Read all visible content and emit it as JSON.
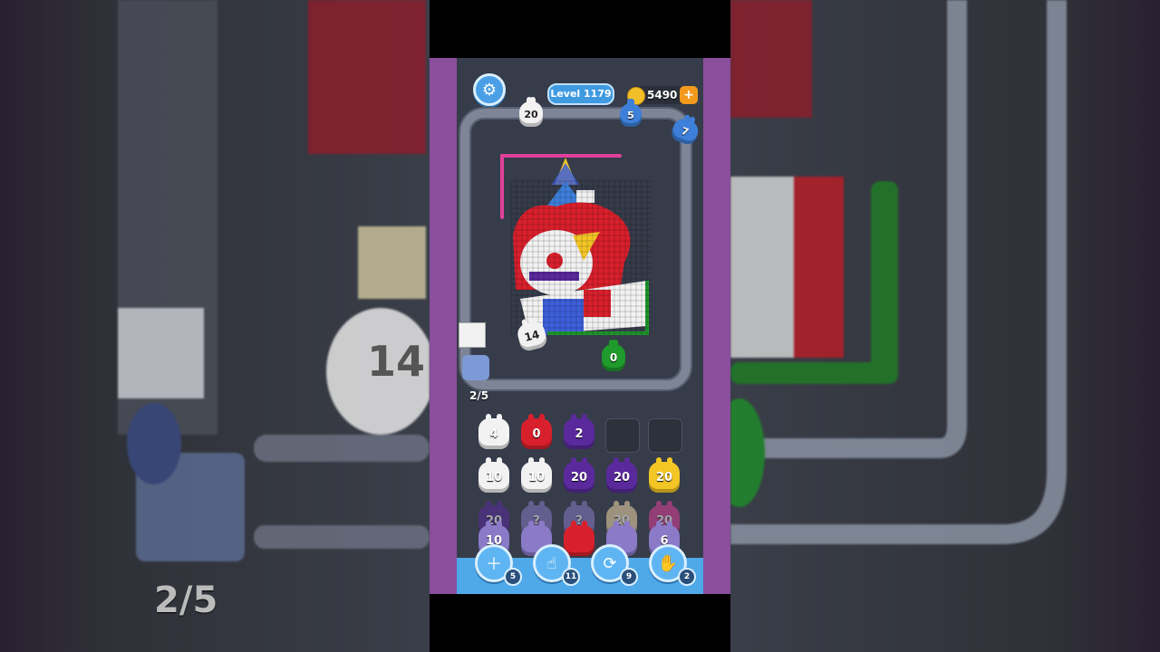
{
  "hud": {
    "level_label": "Level 1179",
    "coins": "5490",
    "add_coins_icon": "plus-icon",
    "settings_icon": "gear-icon"
  },
  "track_shooters": {
    "top_white": "20",
    "top_blue": "5",
    "corner_blue": "7",
    "green_on_belt": "0",
    "white_on_belt": "14"
  },
  "belt_progress": "2/5",
  "queue": {
    "row1": [
      "4",
      "0",
      "2",
      "",
      ""
    ],
    "row2": [
      "10",
      "10",
      "20",
      "20",
      "20"
    ],
    "row3": [
      "20",
      "?",
      "?",
      "20",
      "20"
    ],
    "row4": [
      "10",
      "",
      "",
      "",
      "6"
    ]
  },
  "tools": [
    {
      "icon": "add-slot-icon",
      "count": "5"
    },
    {
      "icon": "hand-pointer-icon",
      "count": "11"
    },
    {
      "icon": "shuffle-icon",
      "count": "9"
    },
    {
      "icon": "magic-glove-icon",
      "count": "2"
    }
  ],
  "background_blur": {
    "left_progress": "2/5",
    "left_counter": "14"
  },
  "colors": {
    "white": "#f2f2f2",
    "red": "#d8202c",
    "purple": "#5a2a9c",
    "yellow": "#f3c626",
    "pink": "#e0409a",
    "blue": "#3d7fd9",
    "green": "#1f9a2c",
    "lavender": "#8a7ac8",
    "cream": "#f1d9a8"
  }
}
